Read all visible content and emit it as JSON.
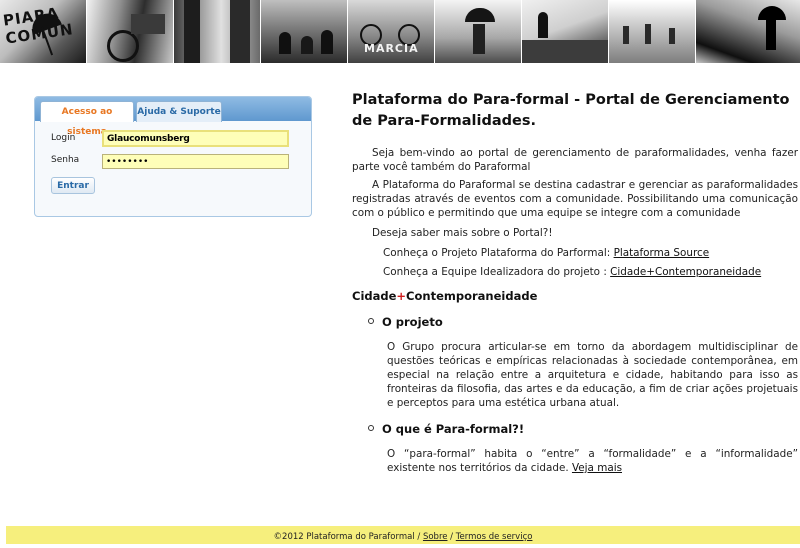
{
  "banner": {
    "photo_captions": [
      "PIARA COMUN",
      "MARCIA"
    ]
  },
  "login": {
    "tabs": [
      {
        "label": "Acesso ao sistema",
        "active": true
      },
      {
        "label": "Ajuda & Suporte",
        "active": false
      }
    ],
    "login_label": "Login",
    "login_value": "Glaucomunsberg",
    "senha_label": "Senha",
    "senha_value": "********",
    "submit_label": "Entrar"
  },
  "main": {
    "title": "Plataforma do Para-formal - Portal de Gerenciamento de Para-Formalidades.",
    "intro_1": "Seja bem-vindo ao portal de gerenciamento de paraformalidades, venha fazer parte você também do Paraformal",
    "intro_2": "A Plataforma do Paraformal se destina cadastrar e gerenciar as paraformalidades registradas através de eventos com a comunidade. Possibilitando uma comunicação com o público e permitindo que uma equipe se integre com a comunidade",
    "question": "Deseja saber mais sobre o Portal?!",
    "project_line_text": "Conheça o Projeto Plataforma do Parformal: ",
    "project_link": "Plataforma Source",
    "team_line_text": "Conheça a Equipe Idealizadora do projeto : ",
    "team_link": "Cidade+Contemporaneidade",
    "section_heading_part1": "Cidade",
    "section_heading_plus": "+",
    "section_heading_part2": "Contemporaneidade",
    "items": [
      {
        "title": "O projeto",
        "text": "O Grupo procura articular-se em torno da abordagem multidisciplinar de questões teóricas e empíricas relacionadas à sociedade contemporânea, em especial na relação entre a arquitetura e cidade, habitando para isso as fronteiras da filosofia, das artes e da educação, a fim de criar ações projetuais e perceptos para uma estética urbana atual."
      },
      {
        "title": "O que é Para-formal?!",
        "text": "O “para-formal” habita o “entre” a “formalidade” e a “informalidade” existente nos territórios da cidade. ",
        "link": "Veja mais"
      }
    ]
  },
  "footer": {
    "copyright": "©2012 Plataforma do Paraformal / ",
    "sobre_link": "Sobre",
    "separator": " / ",
    "terms_link": "Termos de serviço"
  }
}
